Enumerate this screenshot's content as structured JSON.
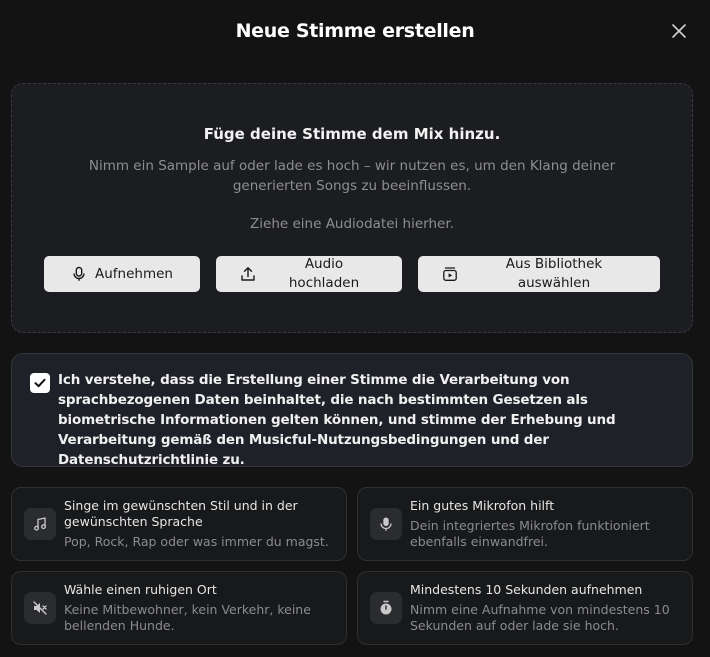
{
  "dialog": {
    "title": "Neue Stimme erstellen"
  },
  "dropzone": {
    "heading": "Füge deine Stimme dem Mix hinzu.",
    "description": "Nimm ein Sample auf oder lade es hoch – wir nutzen es, um den Klang deiner generierten Songs zu beeinflussen.",
    "drop_hint": "Ziehe eine Audiodatei hierher.",
    "buttons": {
      "record": "Aufnehmen",
      "upload": "Audio hochladen",
      "library": "Aus Bibliothek auswählen"
    }
  },
  "consent": {
    "checked": true,
    "text": "Ich verstehe, dass die Erstellung einer Stimme die Verarbeitung von sprachbezogenen Daten beinhaltet, die nach bestimmten Gesetzen als biometrische Informationen gelten können, und stimme der Erhebung und Verarbeitung gemäß den Musicful-Nutzungsbedingungen und der Datenschutzrichtlinie zu."
  },
  "tips": [
    {
      "icon": "music-note-icon",
      "title": "Singe im gewünschten Stil und in der gewünschten Sprache",
      "description": "Pop, Rock, Rap oder was immer du magst."
    },
    {
      "icon": "microphone-icon",
      "title": "Ein gutes Mikrofon hilft",
      "description": "Dein integriertes Mikrofon funktioniert ebenfalls einwandfrei."
    },
    {
      "icon": "mute-icon",
      "title": "Wähle einen ruhigen Ort",
      "description": "Keine Mitbewohner, kein Verkehr, keine bellenden Hunde."
    },
    {
      "icon": "stopwatch-icon",
      "title": "Mindestens 10 Sekunden aufnehmen",
      "description": "Nimm eine Aufnahme von mindestens 10 Sekunden auf oder lade sie hoch."
    }
  ],
  "colors": {
    "background": "#131314",
    "dropzone_bg": "#1c1d21",
    "consent_bg": "#1f2128",
    "button_bg": "#e8e8e8",
    "muted_text": "#8d8e93"
  }
}
